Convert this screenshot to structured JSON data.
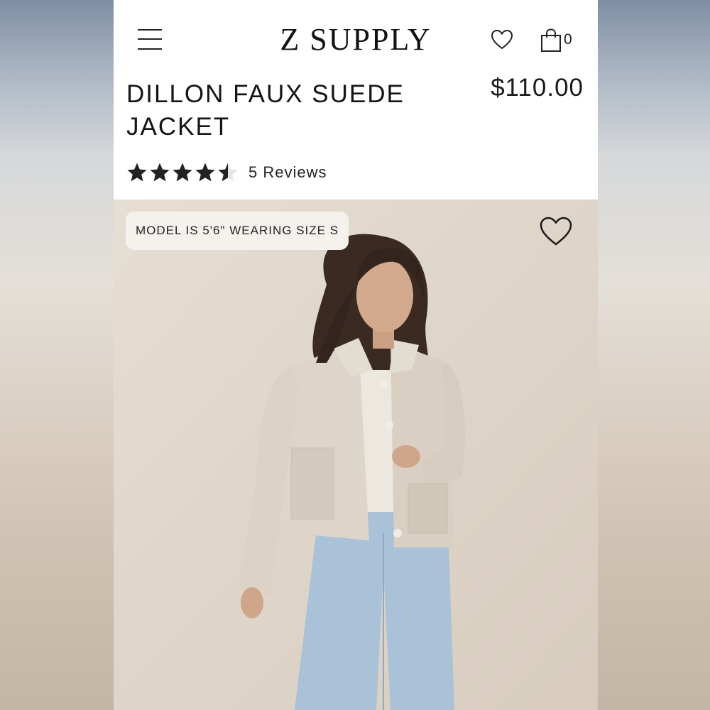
{
  "header": {
    "brand": "Z SUPPLY",
    "bag_count": "0"
  },
  "product": {
    "title": "DILLON FAUX SUEDE JACKET",
    "price": "$110.00",
    "rating": 4.5,
    "rating_max": 5,
    "reviews_label": "5 Reviews"
  },
  "image": {
    "model_info": "MODEL IS 5'6\" WEARING SIZE S"
  },
  "icons": {
    "menu": "hamburger-menu-icon",
    "wishlist": "heart-icon",
    "bag": "shopping-bag-icon",
    "star": "star-icon"
  },
  "colors": {
    "text": "#151515",
    "star": "#222222",
    "tag_background": "#f5f2ed",
    "jacket": "#ddd5c9",
    "jeans": "#a9c2d8"
  }
}
